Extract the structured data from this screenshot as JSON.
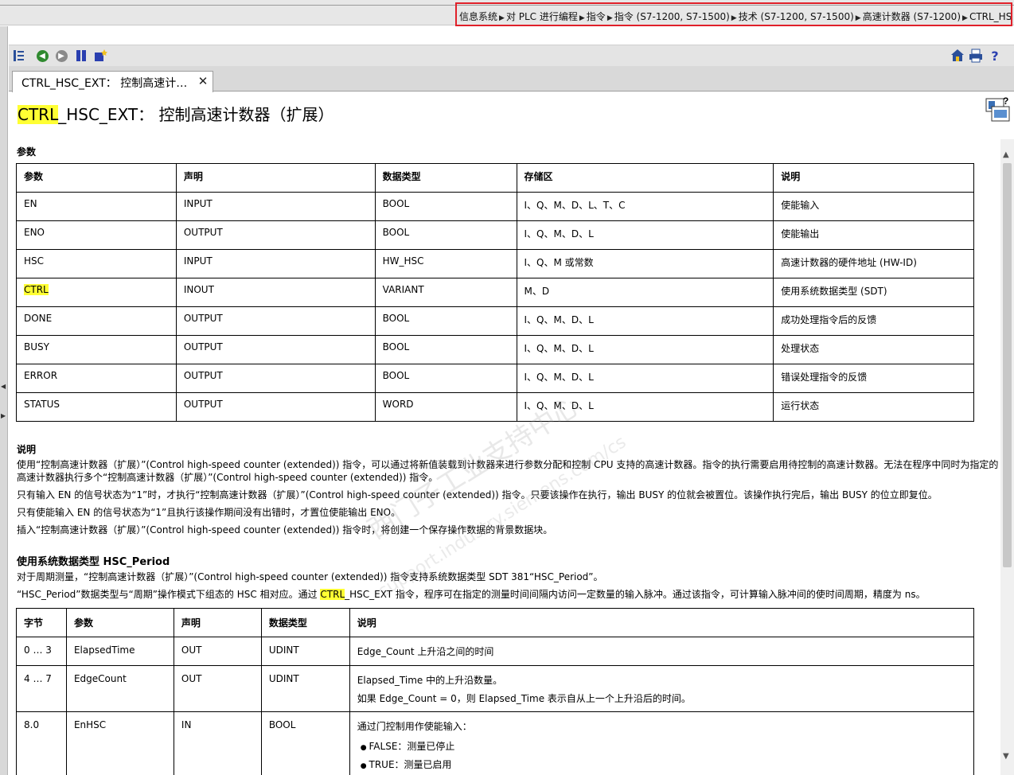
{
  "breadcrumb": [
    "信息系统",
    "对 PLC 进行编程",
    "指令",
    "指令 (S7-1200, S7-1500)",
    "技术 (S7-1200, S7-1500)",
    "高速计数器 (S7-1200)",
    "CTRL_HSC_..."
  ],
  "breadcrumb_sep": "▶",
  "tab": {
    "label": "CTRL_HSC_EXT： 控制高速计…",
    "close": "✕"
  },
  "title": {
    "highlight": "CTRL",
    "rest": "_HSC_EXT： 控制高速计数器（扩展）"
  },
  "params": {
    "heading": "参数",
    "headers": [
      "参数",
      "声明",
      "数据类型",
      "存储区",
      "说明"
    ],
    "rows": [
      [
        "EN",
        "INPUT",
        "BOOL",
        "I、Q、M、D、L、T、C",
        "使能输入"
      ],
      [
        "ENO",
        "OUTPUT",
        "BOOL",
        "I、Q、M、D、L",
        "使能输出"
      ],
      [
        "HSC",
        "INPUT",
        "HW_HSC",
        "I、Q、M 或常数",
        "高速计数器的硬件地址 (HW-ID)"
      ],
      [
        "CTRL",
        "INOUT",
        "VARIANT",
        "M、D",
        "使用系统数据类型 (SDT)"
      ],
      [
        "DONE",
        "OUTPUT",
        "BOOL",
        "I、Q、M、D、L",
        "成功处理指令后的反馈"
      ],
      [
        "BUSY",
        "OUTPUT",
        "BOOL",
        "I、Q、M、D、L",
        "处理状态"
      ],
      [
        "ERROR",
        "OUTPUT",
        "BOOL",
        "I、Q、M、D、L",
        "错误处理指令的反馈"
      ],
      [
        "STATUS",
        "OUTPUT",
        "WORD",
        "I、Q、M、D、L",
        "运行状态"
      ]
    ]
  },
  "description": {
    "heading": "说明",
    "p1": "使用“控制高速计数器（扩展）”(Control high-speed counter (extended)) 指令，可以通过将新值装载到计数器来进行参数分配和控制 CPU 支持的高速计数器。指令的执行需要启用待控制的高速计数器。无法在程序中同时为指定的高速计数器执行多个“控制高速计数器（扩展）”(Control high-speed counter (extended)) 指令。",
    "p2": "只有输入 EN 的信号状态为“1”时，才执行“控制高速计数器（扩展）”(Control high-speed counter (extended)) 指令。只要该操作在执行，输出 BUSY 的位就会被置位。该操作执行完后，输出 BUSY 的位立即复位。",
    "p3": "只有使能输入 EN 的信号状态为“1”且执行该操作期间没有出错时，才置位使能输出 ENO。",
    "p4": "插入“控制高速计数器（扩展）”(Control high-speed counter (extended)) 指令时，将创建一个保存操作数据的背景数据块。"
  },
  "sdt": {
    "heading": "使用系统数据类型 HSC_Period",
    "p1": "对于周期测量，“控制高速计数器（扩展）”(Control high-speed counter (extended)) 指令支持系统数据类型 SDT 381“HSC_Period”。",
    "p2_pre": "“HSC_Period”数据类型与“周期”操作模式下组态的 HSC 相对应。通过 ",
    "p2_hl": "CTRL",
    "p2_post": "_HSC_EXT 指令，程序可在指定的测量时间间隔内访问一定数量的输入脉冲。通过该指令，可计算输入脉冲间的使时间周期，精度为 ns。",
    "headers": [
      "字节",
      "参数",
      "声明",
      "数据类型",
      "说明"
    ],
    "rows": [
      {
        "c": [
          "0 … 3",
          "ElapsedTime",
          "OUT",
          "UDINT"
        ],
        "d": "Edge_Count 上升沿之间的时间",
        "d2": ""
      },
      {
        "c": [
          "4 … 7",
          "EdgeCount",
          "OUT",
          "UDINT"
        ],
        "d": "Elapsed_Time 中的上升沿数量。",
        "d2": "如果 Edge_Count = 0，则 Elapsed_Time 表示自从上一个上升沿后的时间。"
      },
      {
        "c": [
          "8.0",
          "EnHSC",
          "IN",
          "BOOL"
        ],
        "d": "通过门控制用作使能输入：",
        "d2": ""
      }
    ],
    "bullets": [
      "FALSE：测量已停止",
      "TRUE：测量已启用"
    ]
  },
  "watermark": {
    "line1": "西门子工业支持中心",
    "line2": "support.industry.siemens.com/cs"
  }
}
